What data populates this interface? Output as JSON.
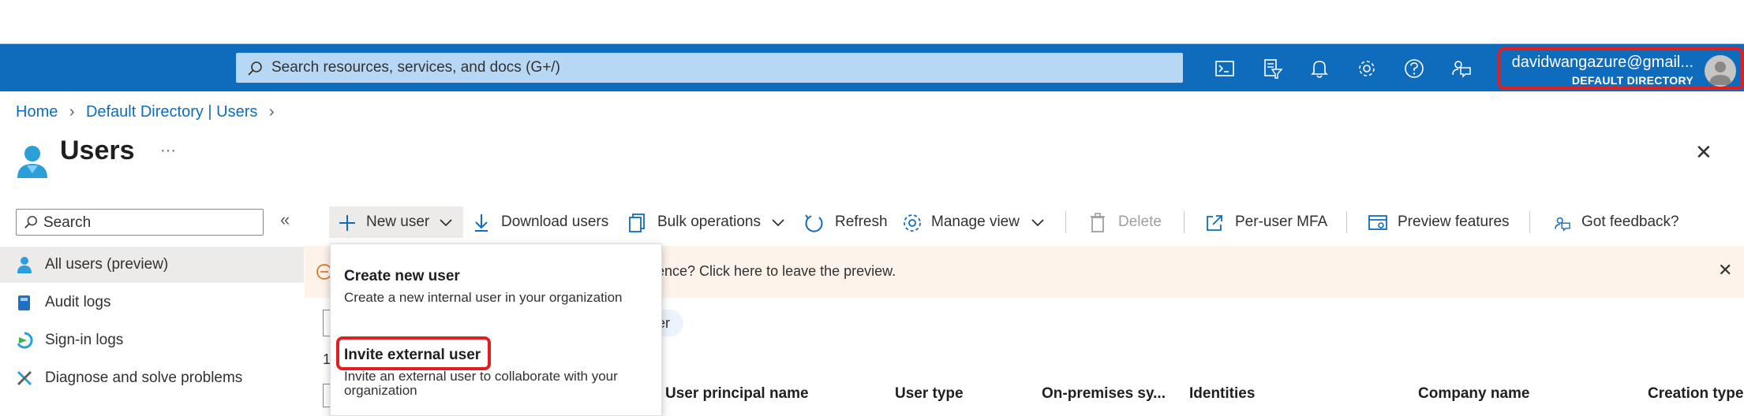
{
  "topbar": {
    "search_placeholder": "Search resources, services, and docs (G+/)",
    "icons": [
      "cloud-shell-icon",
      "directory-filter-icon",
      "notifications-icon",
      "settings-icon",
      "help-icon",
      "feedback-icon"
    ],
    "account_name": "davidwangazure@gmail...",
    "account_directory": "DEFAULT DIRECTORY",
    "color": "#0f6cbd"
  },
  "breadcrumb": [
    "Home",
    "Default Directory | Users"
  ],
  "page": {
    "title": "Users",
    "more": "···",
    "close": "✕"
  },
  "nav": {
    "search_placeholder": "Search",
    "collapse": "«",
    "items": [
      {
        "label": "All users (preview)",
        "icon": "user-icon"
      },
      {
        "label": "Audit logs",
        "icon": "audit-log-icon"
      },
      {
        "label": "Sign-in logs",
        "icon": "sign-in-icon"
      },
      {
        "label": "Diagnose and solve problems",
        "icon": "wrench-icon"
      }
    ]
  },
  "toolbar": {
    "new_user": "New user",
    "download_users": "Download users",
    "bulk_operations": "Bulk operations",
    "refresh": "Refresh",
    "manage_view": "Manage view",
    "delete": "Delete",
    "per_user_mfa": "Per-user MFA",
    "preview_features": "Preview features",
    "got_feedback": "Got feedback?"
  },
  "banner": {
    "text": "ence? Click here to leave the preview."
  },
  "filter_chip": "er",
  "count_partial": "1",
  "dropdown": {
    "items": [
      {
        "title": "Create new user",
        "description": "Create a new internal user in your organization"
      },
      {
        "title": "Invite external user",
        "description": "Invite an external user to collaborate with your organization"
      }
    ]
  },
  "table": {
    "columns": [
      "User principal name",
      "User type",
      "On-premises sy...",
      "Identities",
      "Company name",
      "Creation type"
    ]
  }
}
